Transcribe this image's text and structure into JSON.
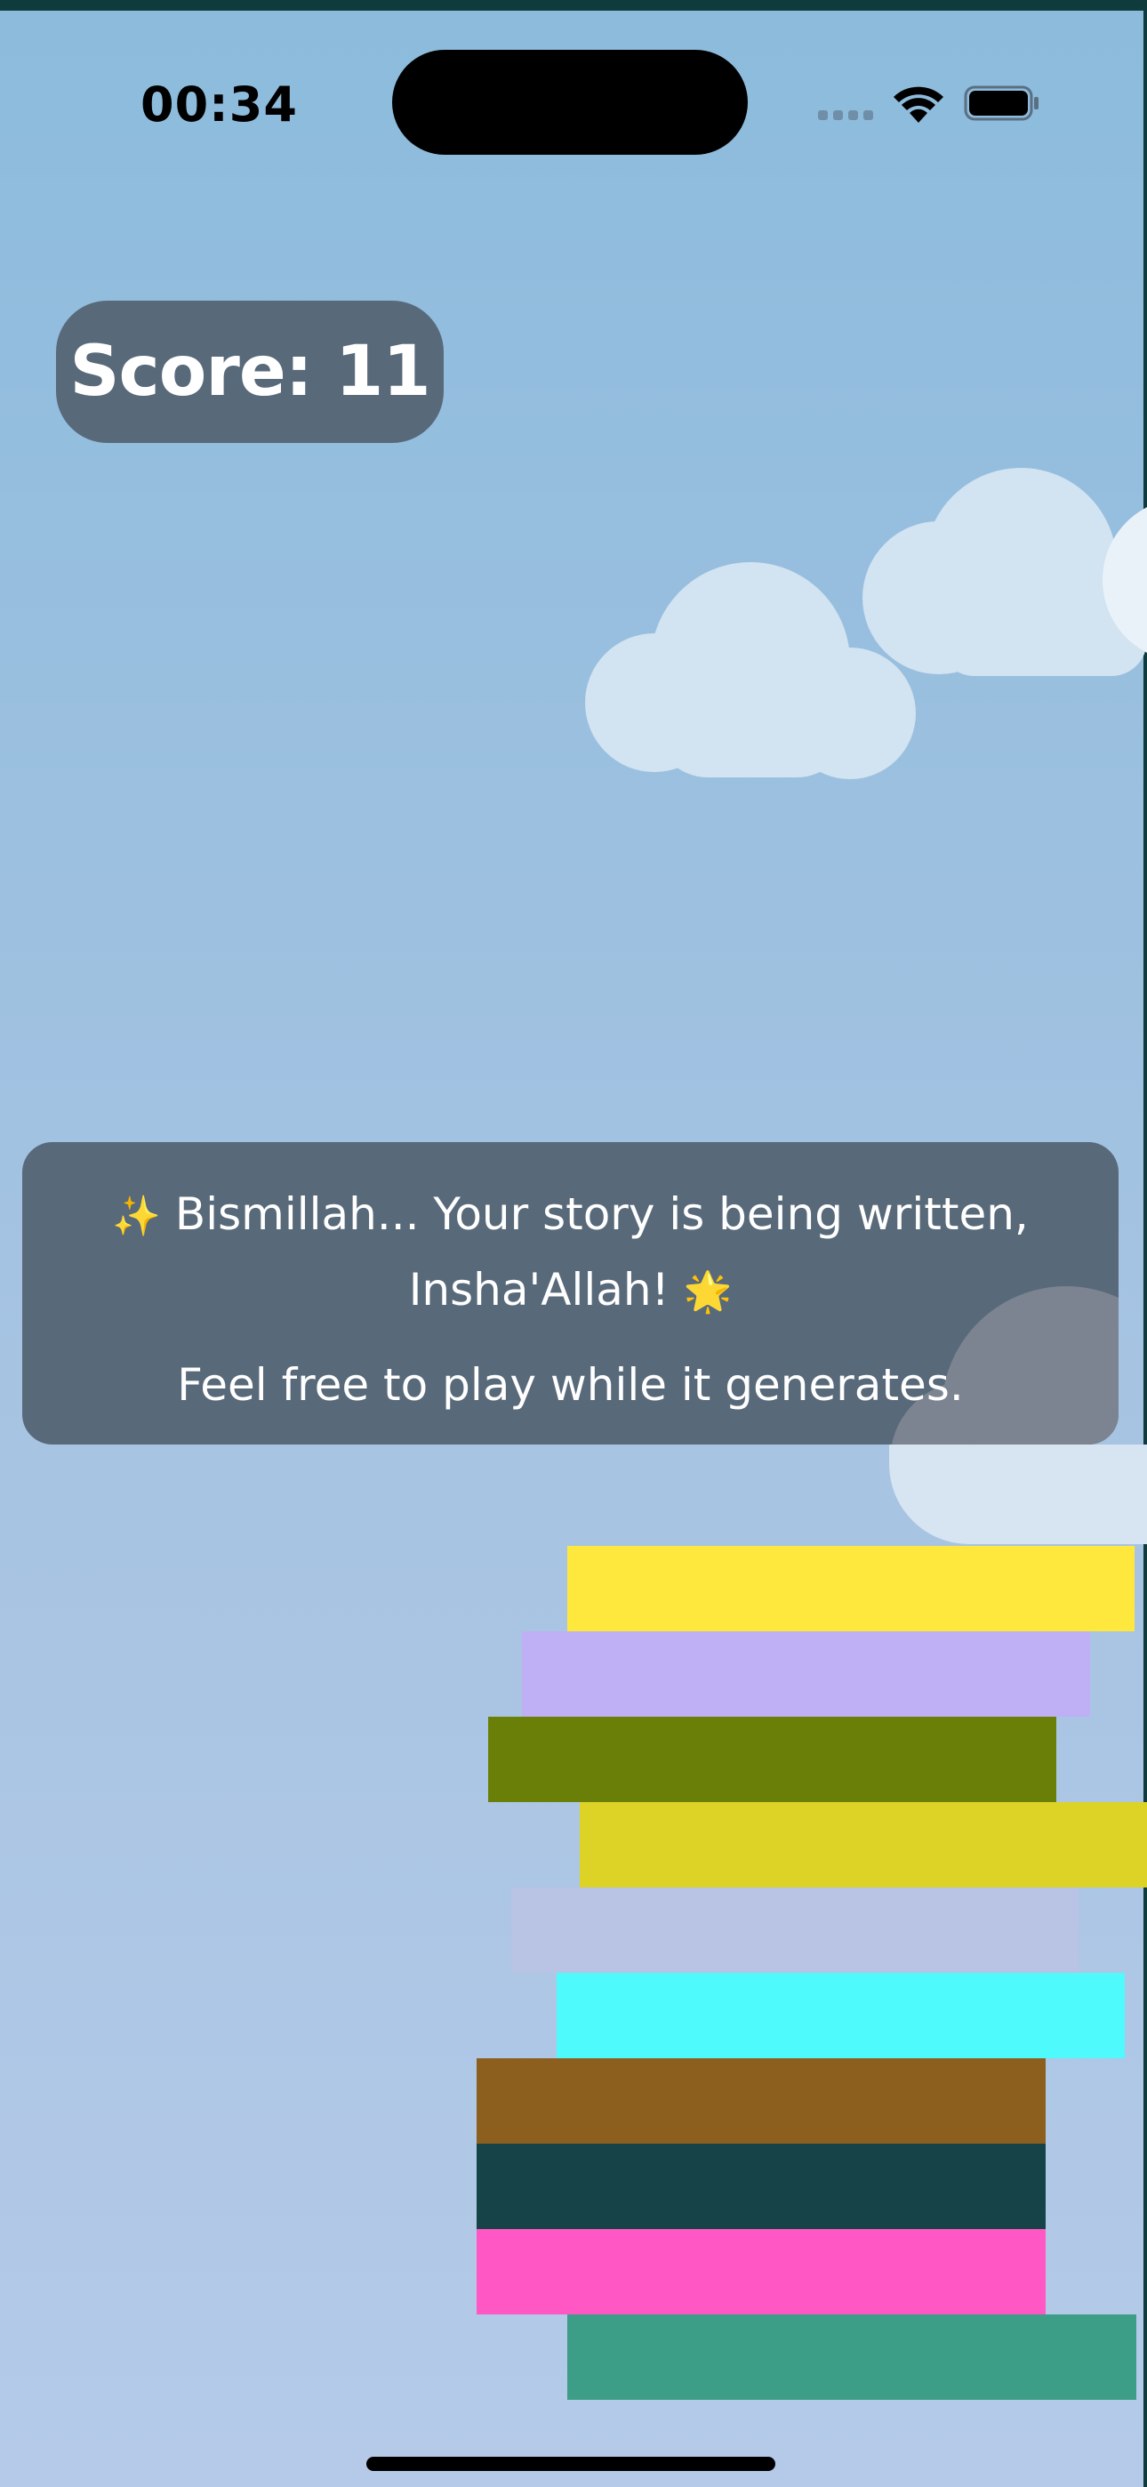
{
  "status_bar": {
    "time": "00:34"
  },
  "hud": {
    "score_text": "Score: 11"
  },
  "banner": {
    "icon_left": "✨",
    "line1_text": "Bismillah... Your story is being written,",
    "line1b_text": "Insha'Allah!",
    "icon_right": "🌟",
    "line2_text": "Feel free to play while it generates."
  },
  "stack_blocks": [
    {
      "color": "#ffe83d"
    },
    {
      "color": "#bfaff5"
    },
    {
      "color": "#6a7f07"
    },
    {
      "color": "#dcd326"
    },
    {
      "color": "#b9c3e4"
    },
    {
      "color": "#4efafc"
    },
    {
      "color": "#8d5f1f"
    },
    {
      "color": "#164347"
    },
    {
      "color": "#ff57c4"
    },
    {
      "color": "#3c9e86"
    }
  ],
  "colors": {
    "sky_top": "#8cbbdc",
    "sky_bottom": "#b4cae8",
    "hud_bg": "#58697a",
    "cloud": "#d2e3f1"
  }
}
